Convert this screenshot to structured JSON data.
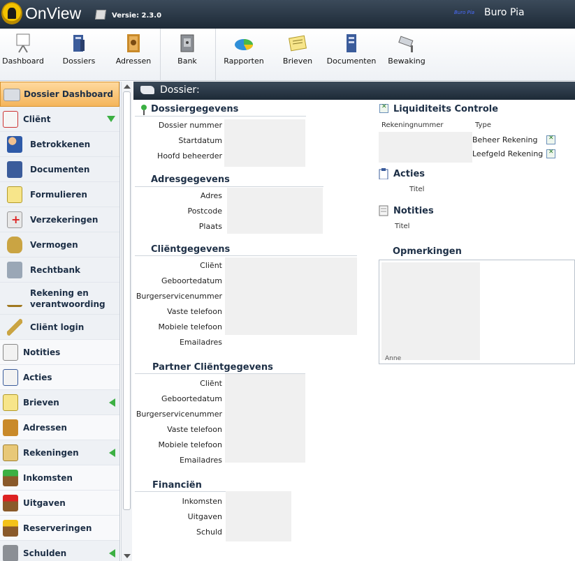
{
  "header": {
    "app_name": "OnView",
    "version": "Versie: 2.3.0",
    "mini_logo": "Buro Pia",
    "org_name": "Buro Pia"
  },
  "toolbar": {
    "items": [
      {
        "label": "Dashboard",
        "icon": "dashboard-icon"
      },
      {
        "label": "Dossiers",
        "icon": "dossiers-icon"
      },
      {
        "label": "Adressen",
        "icon": "adressen-icon"
      },
      {
        "label": "Bank",
        "icon": "bank-icon"
      },
      {
        "label": "Rapporten",
        "icon": "rapporten-icon"
      },
      {
        "label": "Brieven",
        "icon": "brieven-icon"
      },
      {
        "label": "Documenten",
        "icon": "documenten-icon"
      },
      {
        "label": "Bewaking",
        "icon": "bewaking-icon"
      }
    ]
  },
  "sidebar": {
    "items": [
      {
        "label": "Dossier Dashboard"
      },
      {
        "label": "Cliënt"
      },
      {
        "label": "Betrokkenen"
      },
      {
        "label": "Documenten"
      },
      {
        "label": "Formulieren"
      },
      {
        "label": "Verzekeringen"
      },
      {
        "label": "Vermogen"
      },
      {
        "label": "Rechtbank"
      },
      {
        "label": "Rekening en verantwoording"
      },
      {
        "label": "Cliënt login"
      },
      {
        "label": "Notities"
      },
      {
        "label": "Acties"
      },
      {
        "label": "Brieven"
      },
      {
        "label": "Adressen"
      },
      {
        "label": "Rekeningen"
      },
      {
        "label": "Inkomsten"
      },
      {
        "label": "Uitgaven"
      },
      {
        "label": "Reserveringen"
      },
      {
        "label": "Schulden"
      }
    ]
  },
  "dossier": {
    "title": "Dossier:",
    "dossiergegevens": {
      "title": "Dossiergegevens",
      "fields": [
        "Dossier nummer",
        "Startdatum",
        "Hoofd beheerder"
      ]
    },
    "adresgegevens": {
      "title": "Adresgegevens",
      "fields": [
        "Adres",
        "Postcode",
        "Plaats"
      ]
    },
    "clientgegevens": {
      "title": "Cliëntgegevens",
      "fields": [
        "Cliënt",
        "Geboortedatum",
        "Burgerservicenummer",
        "Vaste telefoon",
        "Mobiele telefoon",
        "Emailadres"
      ]
    },
    "partner": {
      "title": "Partner Cliëntgegevens",
      "fields": [
        "Cliënt",
        "Geboortedatum",
        "Burgerservicenummer",
        "Vaste telefoon",
        "Mobiele telefoon",
        "Emailadres"
      ]
    },
    "financien": {
      "title": "Financiën",
      "fields": [
        "Inkomsten",
        "Uitgaven",
        "Schuld"
      ]
    },
    "liquiditeit": {
      "title": "Liquiditeits Controle",
      "col_rekening": "Rekeningnummer",
      "col_type": "Type",
      "rows": [
        "Beheer Rekening",
        "Leefgeld Rekening"
      ]
    },
    "acties": {
      "title": "Acties",
      "col": "Titel"
    },
    "notities": {
      "title": "Notities",
      "col": "Titel"
    },
    "opmerkingen": {
      "title": "Opmerkingen",
      "text": "Anne"
    }
  },
  "colors": {
    "header_bg": "#1d2a37",
    "active_item": "#f4b55b",
    "accent_green": "#3cb043",
    "heading": "#1d2f46"
  }
}
